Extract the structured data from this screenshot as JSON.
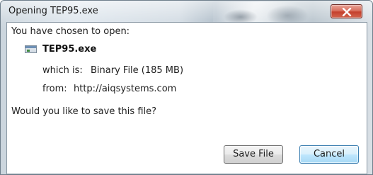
{
  "window": {
    "title": "Opening TEP95.exe",
    "close_icon": "close-icon"
  },
  "dialog": {
    "heading": "You have chosen to open:",
    "file_icon": "executable-file-icon",
    "file_name": "TEP95.exe",
    "which_is_label": "which is:",
    "which_is_value": "Binary File (185 MB)",
    "from_label": "from:",
    "from_value": "http://aiqsystems.com",
    "question": "Would you like to save this file?"
  },
  "buttons": {
    "save_label": "Save File",
    "cancel_label": "Cancel"
  }
}
